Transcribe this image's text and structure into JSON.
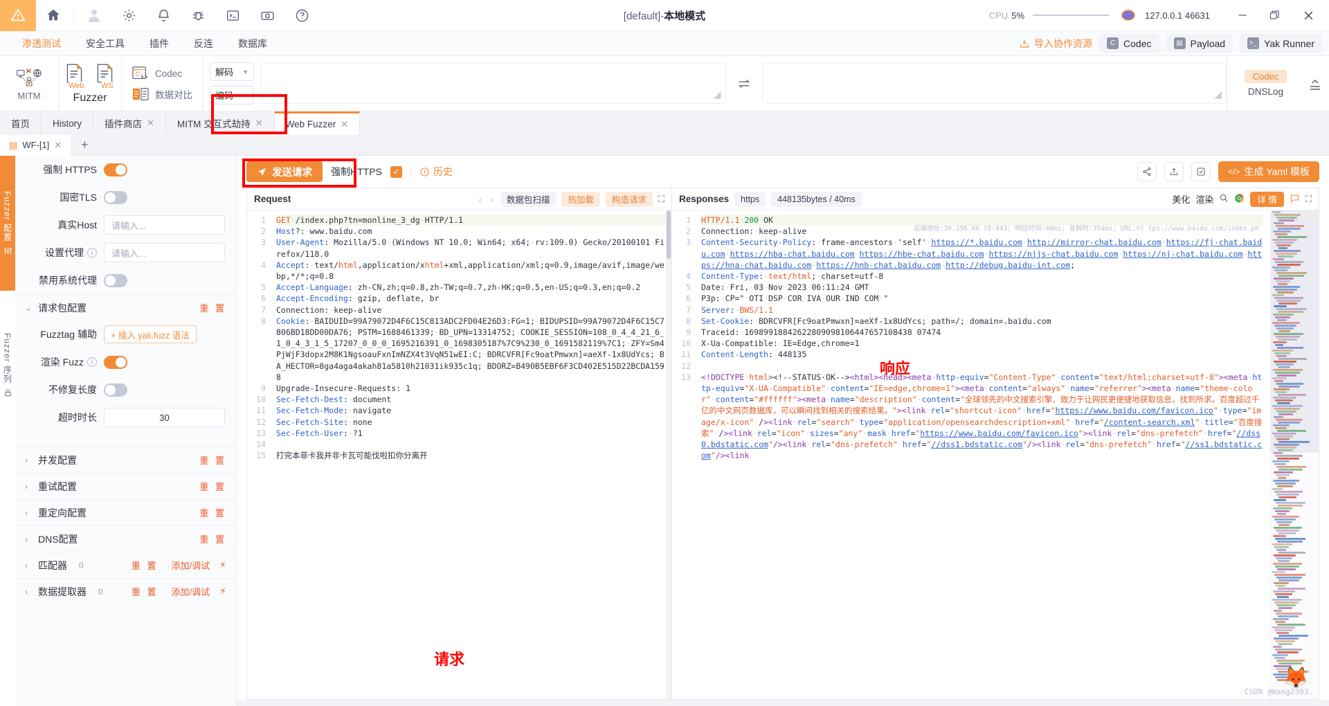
{
  "titlebar": {
    "icons": [
      "warning-icon",
      "home-icon",
      "user-icon",
      "gear-icon",
      "bell-icon",
      "bug-icon",
      "terminal-icon",
      "camera-icon",
      "help-icon"
    ],
    "title_plain": "[default]-",
    "title_bold": "本地模式",
    "cpu_label": "CPU",
    "cpu_value": "5%",
    "address": "127.0.0.1 46631",
    "min": "—",
    "max": "❐",
    "close": "✕"
  },
  "menu": {
    "items": [
      {
        "label": "渗透测试",
        "active": true
      },
      {
        "label": "安全工具",
        "active": false
      },
      {
        "label": "插件",
        "active": false
      },
      {
        "label": "反连",
        "active": false
      },
      {
        "label": "数据库",
        "active": false
      }
    ],
    "import_label": "导入协作资源",
    "pills": [
      {
        "label": "Codec",
        "icon": "codec-icon"
      },
      {
        "label": "Payload",
        "icon": "payload-icon"
      },
      {
        "label": "Yak Runner",
        "icon": "terminal-icon"
      }
    ]
  },
  "ribbon": {
    "mitm_label": "MITM",
    "fuzzer_label": "Fuzzer",
    "fuzzer_web": "Web",
    "fuzzer_ws": "WS",
    "codec_label": "Codec",
    "datacmp_label": "数据对比",
    "decode_label": "解码",
    "encode_label": "编码",
    "codec_badge": "Codec",
    "dnslog_label": "DNSLog"
  },
  "page_tabs": [
    {
      "label": "首页",
      "closable": false,
      "active": false
    },
    {
      "label": "History",
      "closable": false,
      "active": false
    },
    {
      "label": "插件商店",
      "closable": true,
      "active": false
    },
    {
      "label": "MITM 交互式劫持",
      "closable": true,
      "active": false
    },
    {
      "label": "Web Fuzzer",
      "closable": true,
      "active": true
    }
  ],
  "fuzzer_tabs": {
    "tab_label": "WF-[1]",
    "add_label": "+"
  },
  "rail": {
    "config_label": "Fuzzer 配置",
    "sequence_label": "Fuzzer 序列"
  },
  "left_config": {
    "rows": [
      {
        "label": "强制 HTTPS",
        "type": "switch",
        "on": true
      },
      {
        "label": "国密TLS",
        "type": "switch",
        "on": false
      },
      {
        "label": "真实Host",
        "type": "input",
        "placeholder": "请输入...",
        "value": ""
      },
      {
        "label": "设置代理",
        "type": "input",
        "placeholder": "请输入...",
        "value": "",
        "info": true
      },
      {
        "label": "禁用系统代理",
        "type": "switch",
        "on": false
      }
    ],
    "section_request": {
      "label": "请求包配置",
      "reset": "重 置",
      "expanded": true
    },
    "req_rows": [
      {
        "label": "Fuzztag 辅助",
        "type": "button",
        "btn": "+ 插入 yak.fuzz 语法"
      },
      {
        "label": "渲染 Fuzz",
        "type": "switch",
        "on": true,
        "info": true
      },
      {
        "label": "不修复长度",
        "type": "switch",
        "on": false
      },
      {
        "label": "超时时长",
        "type": "input",
        "value": "30"
      }
    ],
    "sections": [
      {
        "label": "并发配置",
        "reset": "重 置"
      },
      {
        "label": "重试配置",
        "reset": "重 置"
      },
      {
        "label": "重定向配置",
        "reset": "重 置"
      },
      {
        "label": "DNS配置",
        "reset": "重 置"
      },
      {
        "label": "匹配器",
        "count": "0",
        "reset": "重 置",
        "add": "添加/调试"
      },
      {
        "label": "数据提取器",
        "count": "0",
        "reset": "重 置",
        "add": "添加/调试"
      }
    ]
  },
  "sendbar": {
    "send_label": "发送请求",
    "force_label": "强制",
    "https_label": "HTTPS",
    "history_label": "历史",
    "yaml_label": "生成 Yaml 模板",
    "icons": [
      "share-icon",
      "export-icon",
      "check-square-icon"
    ]
  },
  "request_panel": {
    "title": "Request",
    "prev": "‹",
    "next": "›",
    "btn_scan": "数据包扫描",
    "btn_hot": "热加载",
    "btn_build": "构造请求",
    "expand_icon": "expand-icon",
    "note": "请求",
    "lines": [
      {
        "n": 1,
        "html": "<span class='k-orange'>GET</span><span class='dot'>·</span>/index.php?tn=monline_3_dg<span class='dot'>·</span>HTTP/1.1"
      },
      {
        "n": 2,
        "html": "<span class='k-blue'>Host</span><span class='k-gray'>?</span>:<span class='dot'>·</span>www.baidu.com"
      },
      {
        "n": 3,
        "html": "<span class='k-blue'>User-Agent</span>:<span class='dot'>·</span>Mozilla/5.0<span class='dot'>·</span>(Windows<span class='dot'>·</span>NT<span class='dot'>·</span>10.0;<span class='dot'>·</span>Win64;<span class='dot'>·</span>x64;<span class='dot'>·</span>rv:109.0)<span class='dot'>·</span>Gecko/20100101<span class='dot'>·</span>Firefox/118.0"
      },
      {
        "n": 4,
        "html": "<span class='k-blue'>Accept</span>:<span class='dot'>·</span>text/<span class='k-orange'>html</span>,application/x<span class='k-orange'>html</span>+xml,application/xml;q=0.9,image/avif,image/webp,*/*;q=0.8"
      },
      {
        "n": 5,
        "html": "<span class='k-blue'>Accept-Language</span>:<span class='dot'>·</span>zh-CN,zh;q=0.8,zh-TW;q=0.7,zh-HK;q=0.5,en-US;q=0.3,en;q=0.2"
      },
      {
        "n": 6,
        "html": "<span class='k-blue'>Accept-Encoding</span>:<span class='dot'>·</span>gzip,<span class='dot'>·</span>deflate,<span class='dot'>·</span>br"
      },
      {
        "n": 7,
        "html": "Connection:<span class='dot'>·</span>keep-alive"
      },
      {
        "n": 8,
        "html": "<span class='k-blue'>Cookie</span>:<span class='dot'>·</span>BAIDUID=99A79072D4F6C15C813ADC2FD04E26D3:FG=1;<span class='dot'>·</span>BIDUPSID=99A79072D4F6C15C7806BD18DD00DA76;<span class='dot'>·</span>PSTM=1688461339;<span class='dot'>·</span>BD_UPN=13314752;<span class='dot'>·</span>COOKIE_SESSION=108_0_4_4_21_6_1_0_4_3_1_5_17207_0_0_0_1695216391_0_1698305187%7C9%230_0_1691582119%7C1;<span class='dot'>·</span>ZFY=Sm4PjWjF3dopx2M8K1NgsoauFxnImNZX4t3VqN51wEI:C;<span class='dot'>·</span>BDRCVFR[Fc9oatPmwxn]=aeXf-1x8UdYcs;<span class='dot'>·</span>BA_HECTOR=8ga4aga4akah81a5810h21031ik935c1q;<span class='dot'>·</span>BDORZ=B490B5EBF6F3CD402E515D22BCDA1598"
      },
      {
        "n": 9,
        "html": "Upgrade-Insecure-Requests:<span class='dot'>·</span>1"
      },
      {
        "n": 10,
        "html": "<span class='k-blue'>Sec-Fetch-Dest</span>:<span class='dot'>·</span>document"
      },
      {
        "n": 11,
        "html": "<span class='k-blue'>Sec-Fetch-Mode</span>:<span class='dot'>·</span>navigate"
      },
      {
        "n": 12,
        "html": "<span class='k-blue'>Sec-Fetch-Site</span>:<span class='dot'>·</span>none"
      },
      {
        "n": 13,
        "html": "<span class='k-blue'>Sec-Fetch-User</span>:<span class='dot'>·</span>?1"
      },
      {
        "n": 14,
        "html": ""
      },
      {
        "n": 15,
        "html": "打完本菲卡我并非卡瓦可能伐啦扣你分离开"
      }
    ]
  },
  "response_panel": {
    "title": "Responses",
    "badge_https": "https",
    "badge_size": "448135bytes / 40ms",
    "btn_beautify": "美化",
    "btn_render": "渲染",
    "search_icon": "search-icon",
    "chrome_icon": "chrome-icon",
    "detail_label": "详 情",
    "comment_icon": "comment-icon",
    "expand_icon": "expand-icon",
    "note": "响应",
    "float_text": "远端地址:39.156.66.18:443;  响应时间:40ms;  总耗时:354ms;  URL:ht tps://www.baidu.com/index.ph",
    "watermark": "CSDN @Wang2303.",
    "lines": [
      {
        "n": 1,
        "html": "<span class='k-orange'>HTTP/1.1</span><span class='dot'>·</span><span class='k-green'>200</span><span class='dot'>·</span>OK"
      },
      {
        "n": 2,
        "html": "Connection:<span class='dot'>·</span>keep-alive"
      },
      {
        "n": 3,
        "html": "<span class='k-blue'>Content-Security-Policy</span>:<span class='dot'>·</span>frame-ancestors<span class='dot'>·</span>'self'<span class='dot'>·</span><span class='k-link'>https://*.baidu.com</span><span class='dot'>·</span><span class='k-link'>http://mirror-chat.baidu.com</span><span class='dot'>·</span><span class='k-link'>https://fj-chat.baidu.com</span><span class='dot'>·</span><span class='k-link'>https://hba-chat.baidu.com</span><span class='dot'>·</span><span class='k-link'>https://hbe-chat.baidu.com</span><span class='dot'>·</span><span class='k-link'>https://njjs-chat.baidu.com</span><span class='dot'>·</span><span class='k-link'>https://nj-chat.baidu.com</span><span class='dot'>·</span><span class='k-link'>https://hna-chat.baidu.com</span><span class='dot'>·</span><span class='k-link'>https://hnb-chat.baidu.com</span><span class='dot'>·</span><span class='k-link'>http://debug.baidu-int.com</span>;"
      },
      {
        "n": 4,
        "html": "<span class='k-blue'>Content-Type</span>:<span class='dot'>·</span><span class='k-orange'>text/html</span>;<span class='dot'>·</span>charset=utf-8"
      },
      {
        "n": 5,
        "html": "Date:<span class='dot'>·</span>Fri,<span class='dot'>·</span>03<span class='dot'>·</span>Nov<span class='dot'>·</span>2023<span class='dot'>·</span>06:11:24<span class='dot'>·</span>GMT"
      },
      {
        "n": 6,
        "html": "P3p:<span class='dot'>·</span>CP=\"<span class='dot'>·</span>OTI<span class='dot'>·</span>DSP<span class='dot'>·</span>COR<span class='dot'>·</span>IVA<span class='dot'>·</span>OUR<span class='dot'>·</span>IND<span class='dot'>·</span>COM<span class='dot'>·</span>\""
      },
      {
        "n": 7,
        "html": "<span class='k-blue'>Server</span>:<span class='dot'>·</span><span class='k-orange'>BWS/1.1</span>"
      },
      {
        "n": 8,
        "html": "<span class='k-blue'>Set-Cookie</span>:<span class='dot'>·</span>BDRCVFR[Fc9oatPmwxn]=aeXf-1x8UdYcs;<span class='dot'>·</span>path=/;<span class='dot'>·</span>domain=.baidu.com"
      },
      {
        "n": 9,
        "html": "Traceid:<span class='dot'>·</span>16989918842622809098106447657108438 07474"
      },
      {
        "n": 10,
        "html": "X-Ua-Compatible:<span class='dot'>·</span>IE=Edge,chrome=1"
      },
      {
        "n": 11,
        "html": "<span class='k-blue'>Content-Length</span>:<span class='dot'>·</span>448135"
      },
      {
        "n": 12,
        "html": ""
      },
      {
        "n": 13,
        "html": "<span class='k-purple'>&lt;!DOCTYPE</span><span class='dot'>·</span><span class='k-orange'>html</span><span class='k-purple'>&gt;</span><span class='k-gray'>&lt;!--STATUS·OK--&gt;</span><span class='k-purple'>&lt;html&gt;&lt;head&gt;&lt;meta</span><span class='dot'>·</span><span class='k-blue'>http-equiv</span>=<span class='k-orange'>\"Content-Type\"</span><span class='dot'>·</span><span class='k-blue'>content</span>=<span class='k-orange'>\"text/html;charset=utf-8\"</span><span class='k-purple'>&gt;&lt;meta</span><span class='dot'>·</span><span class='k-blue'>http-equiv</span>=<span class='k-orange'>\"X-UA-Compatible\"</span><span class='dot'>·</span><span class='k-blue'>content</span>=<span class='k-orange'>\"IE=edge,chrome=1\"</span><span class='k-purple'>&gt;&lt;meta</span><span class='dot'>·</span><span class='k-blue'>content</span>=<span class='k-orange'>\"always\"</span><span class='dot'>·</span><span class='k-blue'>name</span>=<span class='k-orange'>\"referrer\"</span><span class='k-purple'>&gt;&lt;meta</span><span class='dot'>·</span><span class='k-blue'>name</span>=<span class='k-orange'>\"theme-color\"</span><span class='dot'>·</span><span class='k-blue'>content</span>=<span class='k-orange'>\"#ffffff\"</span><span class='k-purple'>&gt;&lt;meta</span><span class='dot'>·</span><span class='k-blue'>name</span>=<span class='k-orange'>\"description\"</span><span class='dot'>·</span><span class='k-blue'>content</span>=<span class='k-orange'>\"全球领先的中文搜索引擎、致力于让网民更便捷地获取信息，找到所求。百度超过千亿的中文网页数据库，可以瞬间找到相关的搜索结果。\"</span><span class='k-purple'>&gt;&lt;link</span><span class='dot'>·</span><span class='k-blue'>rel</span>=<span class='k-orange'>\"shortcut·icon\"</span><span class='dot'>·</span><span class='k-blue'>href</span>=<span class='k-orange'>\"<span class='k-link'>https://www.baidu.com/favicon.ico</span>\"</span><span class='dot'>·</span><span class='k-blue'>type</span>=<span class='k-orange'>\"image/x-icon\"</span><span class='dot'>·</span>/<span class='k-purple'>&gt;&lt;link</span><span class='dot'>·</span><span class='k-blue'>rel</span>=<span class='k-orange'>\"search\"</span><span class='dot'>·</span><span class='k-blue'>type</span>=<span class='k-orange'>\"application/opensearchdescription+xml\"</span><span class='dot'>·</span><span class='k-blue'>href</span>=<span class='k-orange'>\"<span class='k-link'>/content-search.xml</span>\"</span><span class='dot'>·</span><span class='k-blue'>title</span>=<span class='k-orange'>\"百度搜索\"</span><span class='dot'>·</span>/<span class='k-purple'>&gt;&lt;link</span><span class='dot'>·</span><span class='k-blue'>rel</span>=<span class='k-orange'>\"icon\"</span><span class='dot'>·</span><span class='k-blue'>sizes</span>=<span class='k-orange'>\"any\"</span><span class='dot'>·</span><span class='k-blue'>mask</span><span class='dot'>·</span><span class='k-blue'>href</span>=<span class='k-orange'>\"<span class='k-link'>https://www.baidu.com/favicon.ico</span>\"</span><span class='k-purple'>&gt;&lt;link</span><span class='dot'>·</span><span class='k-blue'>rel</span>=<span class='k-orange'>\"dns-prefetch\"</span><span class='dot'>·</span><span class='k-blue'>href</span>=<span class='k-orange'>\"<span class='k-link'>//dss0.bdstatic.com</span>\"</span><span class='k-purple'>/&gt;&lt;link</span><span class='dot'>·</span><span class='k-blue'>rel</span>=<span class='k-orange'>\"dns-prefetch\"</span><span class='dot'>·</span><span class='k-blue'>href</span>=<span class='k-orange'>\"<span class='k-link'>//dss1.bdstatic.com</span>\"</span><span class='k-purple'>/&gt;&lt;link</span><span class='dot'>·</span><span class='k-blue'>rel</span>=<span class='k-orange'>\"dns-prefetch\"</span><span class='dot'>·</span><span class='k-blue'>href</span>=<span class='k-orange'>\"<span class='k-link'>//ss1.bdstatic.com</span>\"</span><span class='k-purple'>/&gt;&lt;link</span>"
      }
    ]
  }
}
